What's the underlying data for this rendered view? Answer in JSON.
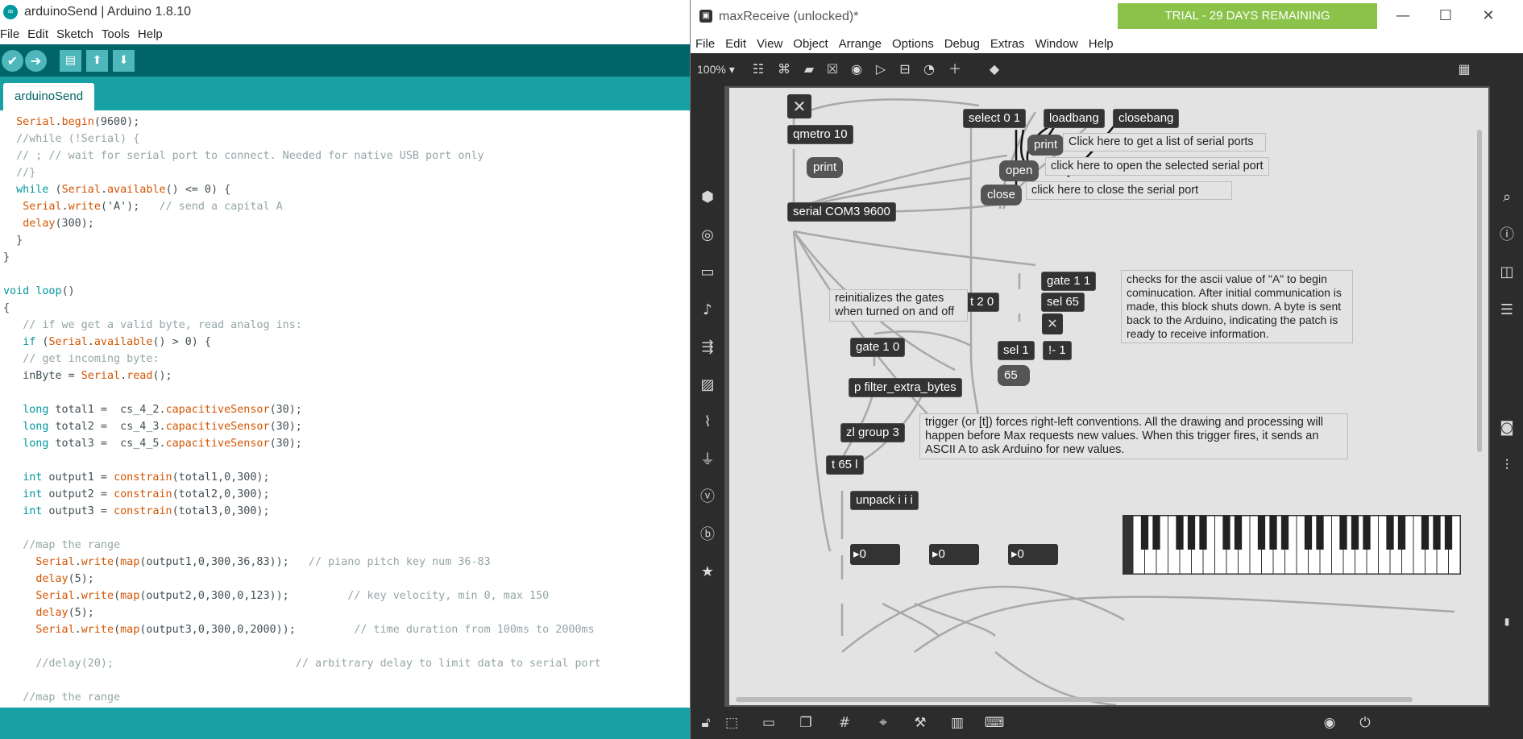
{
  "arduino": {
    "title": "arduinoSend | Arduino 1.8.10",
    "menu": [
      "File",
      "Edit",
      "Sketch",
      "Tools",
      "Help"
    ],
    "toolbar": {
      "verify_glyph": "✔",
      "upload_glyph": "➔",
      "new_glyph": "▤",
      "open_glyph": "⬆",
      "save_glyph": "⬇"
    },
    "tab": "arduinoSend",
    "code_lines": [
      "  Serial.begin(9600);",
      "  //while (!Serial) {",
      "  // ; // wait for serial port to connect. Needed for native USB port only",
      "  //}",
      "  while (Serial.available() <= 0) {",
      "   Serial.write('A');   // send a capital A",
      "   delay(300);",
      "  }",
      "}",
      "",
      "void loop()",
      "{",
      "   // if we get a valid byte, read analog ins:",
      "   if (Serial.available() > 0) {",
      "   // get incoming byte:",
      "   inByte = Serial.read();",
      "",
      "   long total1 =  cs_4_2.capacitiveSensor(30);",
      "   long total2 =  cs_4_3.capacitiveSensor(30);",
      "   long total3 =  cs_4_5.capacitiveSensor(30);",
      "",
      "   int output1 = constrain(total1,0,300);",
      "   int output2 = constrain(total2,0,300);",
      "   int output3 = constrain(total3,0,300);",
      "",
      "   //map the range",
      "     Serial.write(map(output1,0,300,36,83));   // piano pitch key num 36-83",
      "     delay(5);",
      "     Serial.write(map(output2,0,300,0,123));         // key velocity, min 0, max 150",
      "     delay(5);",
      "     Serial.write(map(output3,0,300,0,2000));         // time duration from 100ms to 2000ms",
      "",
      "     //delay(20);                            // arbitrary delay to limit data to serial port",
      "",
      "   //map the range"
    ]
  },
  "max": {
    "title": "maxReceive (unlocked)*",
    "trial": "TRIAL - 29 DAYS REMAINING",
    "menu": [
      "File",
      "Edit",
      "View",
      "Object",
      "Arrange",
      "Options",
      "Debug",
      "Extras",
      "Window",
      "Help"
    ],
    "zoom": "100%",
    "objects": {
      "qmetro": "qmetro 10",
      "print1": "print",
      "serial": "serial COM3 9600",
      "select": "select 0 1",
      "loadbang": "loadbang",
      "closebang": "closebang",
      "print2": "print",
      "open": "open",
      "close": "close",
      "gate11": "gate 1 1",
      "t20": "t 2 0",
      "sel65": "sel 65",
      "gate10": "gate 1 0",
      "sel1": "sel 1",
      "notequal": "!- 1",
      "msg65": "65",
      "pfilter": "p filter_extra_bytes",
      "zlgroup": "zl group 3",
      "t65": "t 65 l",
      "unpack": "unpack i i i",
      "num1": "0",
      "num2": "0",
      "num3": "0"
    },
    "comments": {
      "serial_list": "Click here to get a list of serial ports",
      "open_port": "click here to open the selected serial port",
      "close_port": "click here to close the serial port",
      "reinit": "reinitializes the gates when turned on and off",
      "ascii": "checks for the ascii value of \"A\" to begin cominucation.  After initial communication is made, this block shuts down. A byte is sent back to the Arduino, indicating the patch is ready to receive information.",
      "trigger": "trigger (or [t]) forces right-left conventions.  All the drawing and processing will happen before Max requests new values. When this trigger fires, it sends an ASCII A to ask Arduino for new values."
    },
    "colors": {
      "arduino_dark": "#006468",
      "arduino_teal": "#17a1a5",
      "trial_green": "#8bc34a",
      "max_toolbar": "#2c2c2c",
      "patch_bg": "#e3e3e3"
    }
  }
}
